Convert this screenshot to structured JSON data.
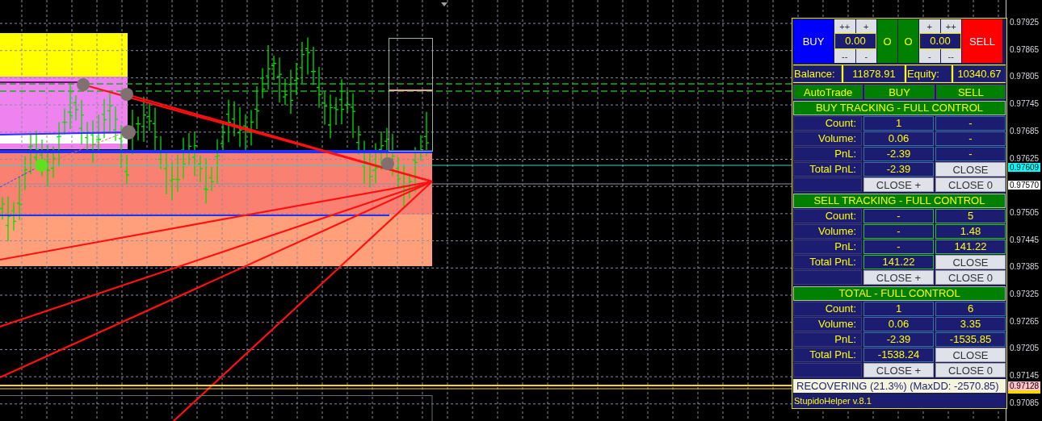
{
  "chart": {
    "price_labels": [
      {
        "kind": "tick",
        "label": "0.97925"
      },
      {
        "kind": "tick",
        "label": "0.97865"
      },
      {
        "kind": "tick",
        "label": "0.97805"
      },
      {
        "kind": "tick",
        "label": "0.97745"
      },
      {
        "kind": "tick",
        "label": "0.97685"
      },
      {
        "kind": "tick",
        "label": "0.97625"
      },
      {
        "kind": "marker",
        "label": "0.97609",
        "color": "#00ffff"
      },
      {
        "kind": "marker",
        "label": "0.97570",
        "color": "#ffffff"
      },
      {
        "kind": "tick",
        "label": "0.97505"
      },
      {
        "kind": "tick",
        "label": "0.97445"
      },
      {
        "kind": "tick",
        "label": "0.97385"
      },
      {
        "kind": "tick",
        "label": "0.97325"
      },
      {
        "kind": "tick",
        "label": "0.97265"
      },
      {
        "kind": "tick",
        "label": "0.97205"
      },
      {
        "kind": "tick",
        "label": "0.97145"
      },
      {
        "kind": "marker",
        "label": "0.97128",
        "color": "#ffc0cb"
      },
      {
        "kind": "tick",
        "label": "0.97085"
      }
    ]
  },
  "panel": {
    "buy_button": "BUY",
    "buy_lot": {
      "plus": [
        "++",
        "+"
      ],
      "value": "0.00",
      "minus": [
        "--",
        "-"
      ]
    },
    "open_buttons": [
      "O",
      "O"
    ],
    "sell_lot": {
      "plus": [
        "+",
        "++"
      ],
      "value": "0.00",
      "minus": [
        "-",
        "--"
      ]
    },
    "sell_button": "SELL",
    "balance": {
      "label": "Balance:",
      "value": "11878.91"
    },
    "equity": {
      "label": "Equity:",
      "value": "10340.67"
    },
    "modes": [
      "AutoTrade",
      "BUY",
      "SELL"
    ],
    "sections": [
      {
        "title": "BUY TRACKING - FULL CONTROL",
        "rows": [
          {
            "label": "Count:",
            "values": [
              "1",
              "-"
            ]
          },
          {
            "label": "Volume:",
            "values": [
              "0.06",
              "-"
            ]
          },
          {
            "label": "PnL:",
            "values": [
              "-2.39",
              "-"
            ]
          }
        ],
        "total": {
          "label": "Total PnL:",
          "value": "-2.39",
          "button": "CLOSE"
        },
        "buttons": [
          "CLOSE +",
          "CLOSE 0"
        ]
      },
      {
        "title": "SELL TRACKING - FULL CONTROL",
        "rows": [
          {
            "label": "Count:",
            "values": [
              "-",
              "5"
            ]
          },
          {
            "label": "Volume:",
            "values": [
              "-",
              "1.48"
            ]
          },
          {
            "label": "PnL:",
            "values": [
              "-",
              "141.22"
            ]
          }
        ],
        "total": {
          "label": "Total PnL:",
          "value": "141.22",
          "button": "CLOSE"
        },
        "buttons": [
          "CLOSE +",
          "CLOSE 0"
        ]
      },
      {
        "title": "TOTAL - FULL CONTROL",
        "rows": [
          {
            "label": "Count:",
            "values": [
              "1",
              "6"
            ]
          },
          {
            "label": "Volume:",
            "values": [
              "0.06",
              "3.35"
            ]
          },
          {
            "label": "PnL:",
            "values": [
              "-2.39",
              "-1535.85"
            ]
          }
        ],
        "total": {
          "label": "Total PnL:",
          "value": "-1538.24",
          "button": "CLOSE"
        },
        "buttons": [
          "CLOSE +",
          "CLOSE 0"
        ]
      }
    ],
    "status": "RECOVERING (21.3%) (MaxDD: -2570.85)",
    "footer": "StupidoHelper v.8.1"
  }
}
